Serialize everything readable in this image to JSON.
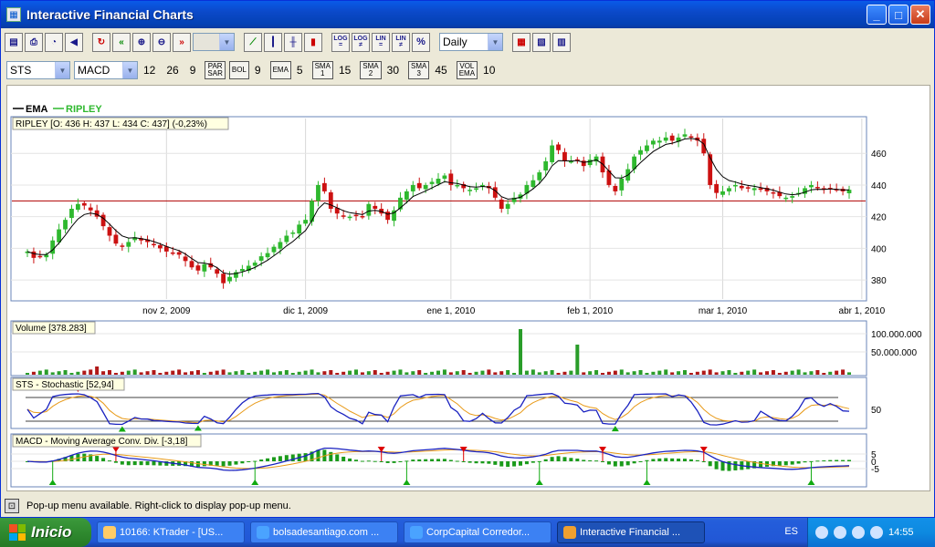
{
  "window": {
    "title": "Interactive Financial Charts"
  },
  "toolbar1": {
    "period_select": "Daily",
    "log_buttons": [
      [
        "LOG",
        "="
      ],
      [
        "LOG",
        "≠"
      ],
      [
        "LIN",
        "="
      ],
      [
        "LIN",
        "≠"
      ],
      [
        "%",
        ""
      ]
    ]
  },
  "toolbar2": {
    "indicator_select": "STS",
    "osc_select": "MACD",
    "macd_params": [
      "12",
      "26",
      "9"
    ],
    "parsar_label": [
      "PAR",
      "SAR"
    ],
    "bol_label": "BOL",
    "bol_value": "9",
    "ema_label": "EMA",
    "ema_value": "5",
    "sma1_label": [
      "SMA",
      "1"
    ],
    "sma1_value": "15",
    "sma2_label": [
      "SMA",
      "2"
    ],
    "sma2_value": "30",
    "sma3_label": [
      "SMA",
      "3"
    ],
    "sma3_value": "45",
    "volema_label": [
      "VOL",
      "EMA"
    ],
    "volema_value": "10"
  },
  "legend": {
    "ema": "EMA",
    "ripley": "RIPLEY"
  },
  "colors": {
    "up": "#2eb82e",
    "down": "#cc1111",
    "ema": "#000000",
    "support": "#b00000",
    "stoch_k": "#1a22c0",
    "stoch_d": "#e89a18",
    "macd_line": "#1a22c0",
    "macd_signal": "#e89a18"
  },
  "chart_data": {
    "price_panel": {
      "type": "candlestick",
      "header": "RIPLEY [O: 436  H: 437  L: 434  C: 437] (-0,23%)",
      "y_ticks": [
        "380",
        "400",
        "420",
        "440",
        "460"
      ],
      "ylim": [
        368,
        482
      ],
      "support_line": 430,
      "x_labels": [
        "nov 2, 2009",
        "dic 1, 2009",
        "ene 1, 2010",
        "feb 1, 2010",
        "mar 1, 2010",
        "abr 1, 2010"
      ],
      "close": [
        398,
        394,
        395,
        396,
        405,
        412,
        418,
        425,
        428,
        427,
        424,
        420,
        414,
        408,
        403,
        401,
        404,
        407,
        405,
        404,
        402,
        400,
        398,
        397,
        396,
        392,
        388,
        386,
        390,
        388,
        384,
        378,
        382,
        385,
        387,
        389,
        391,
        395,
        397,
        401,
        404,
        408,
        410,
        415,
        418,
        430,
        440,
        436,
        425,
        422,
        420,
        420,
        421,
        420,
        428,
        425,
        422,
        418,
        424,
        432,
        436,
        440,
        438,
        440,
        442,
        444,
        446,
        440,
        440,
        438,
        437,
        438,
        440,
        438,
        432,
        425,
        428,
        432,
        434,
        440,
        443,
        448,
        455,
        465,
        462,
        455,
        455,
        456,
        452,
        456,
        458,
        448,
        440,
        436,
        444,
        450,
        458,
        462,
        465,
        468,
        468,
        470,
        468,
        470,
        472,
        470,
        468,
        460,
        440,
        435,
        436,
        438,
        440,
        438,
        438,
        438,
        437,
        436,
        435,
        433,
        432,
        433,
        435,
        438,
        440,
        438,
        437,
        438,
        437,
        436,
        437
      ]
    },
    "volume_panel": {
      "type": "bar",
      "header": "Volume [378.283]",
      "y_ticks": [
        "100.000.000",
        "50.000.000"
      ]
    },
    "stochastic_panel": {
      "type": "line",
      "header": "STS - Stochastic [52,94]",
      "y_ticks": [
        "50"
      ]
    },
    "macd_panel": {
      "type": "line",
      "header": "MACD - Moving Average Conv. Div. [-3,18]",
      "y_ticks": [
        "5",
        "0",
        "-5"
      ]
    }
  },
  "statusbar": {
    "text": "Pop-up menu available. Right-click to display pop-up menu."
  },
  "taskbar": {
    "start_label": "Inicio",
    "tasks": [
      "10166: KTrader - [US...",
      "bolsadesantiago.com ...",
      "CorpCapital Corredor...",
      "Interactive Financial ..."
    ],
    "lang": "ES",
    "clock": "14:55"
  }
}
